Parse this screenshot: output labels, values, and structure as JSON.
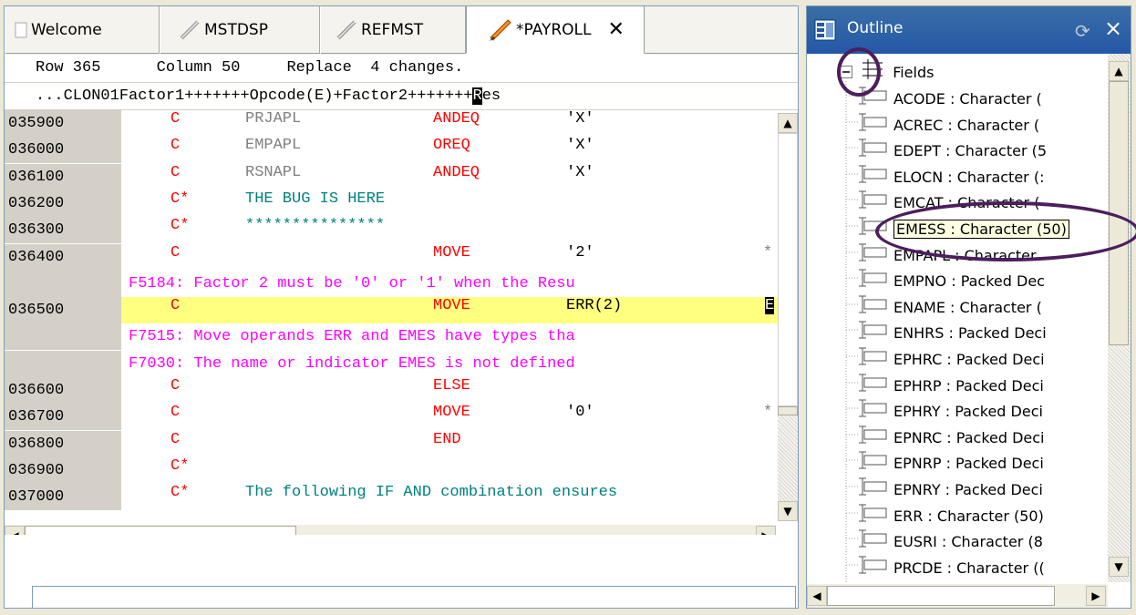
{
  "tabs": [
    {
      "label": "Welcome",
      "icon": "page-icon"
    },
    {
      "label": "MSTDSP",
      "icon": "pencil-icon"
    },
    {
      "label": "REFMST",
      "icon": "pencil-icon"
    },
    {
      "label": "*PAYROLL",
      "icon": "pencil-icon",
      "active": true
    }
  ],
  "editor": {
    "status": "Row 365      Column 50     Replace  4 changes.",
    "ruler_prefix": "...CLON01Factor1+++++++Opcode(E)+Factor2+++++++",
    "ruler_hl": "R",
    "ruler_suffix": "es",
    "lines": [
      {
        "seq": "035900",
        "spec": "C",
        "f1": "PRJAPL",
        "op": "ANDEQ",
        "f2": "'X'"
      },
      {
        "seq": "036000",
        "spec": "C",
        "f1": "EMPAPL",
        "op": "OREQ",
        "f2": "'X'"
      },
      {
        "seq": "036100",
        "spec": "C",
        "f1": "RSNAPL",
        "op": "ANDEQ",
        "f2": "'X'"
      },
      {
        "seq": "036200",
        "spec": "C*",
        "cmt": "THE BUG IS HERE"
      },
      {
        "seq": "036300",
        "spec": "C*",
        "cmt": "***************"
      },
      {
        "seq": "036400",
        "spec": "C",
        "op": "MOVE",
        "f2": "'2'",
        "star": "*"
      },
      {
        "msg": "F5184: Factor 2 must be '0' or '1' when the Resu"
      },
      {
        "seq": "036500",
        "spec": "C",
        "op": "MOVE",
        "f2": "ERR(2)",
        "eblk": "E",
        "current": true
      },
      {
        "msg": "F7515: Move operands ERR and EMES have types tha"
      },
      {
        "msg": "F7030: The name or indicator EMES is not defined"
      },
      {
        "seq": "036600",
        "spec": "C",
        "op": "ELSE"
      },
      {
        "seq": "036700",
        "spec": "C",
        "op": "MOVE",
        "f2": "'0'",
        "star": "*"
      },
      {
        "seq": "036800",
        "spec": "C",
        "op": "END"
      },
      {
        "seq": "036900",
        "spec": "C*"
      },
      {
        "seq": "037000",
        "spec": "C*",
        "cmt": "The following IF AND combination ensures"
      }
    ],
    "command_value": ""
  },
  "outline": {
    "title": "Outline",
    "root": "Fields",
    "items": [
      "ACODE : Character (",
      "ACREC : Character (",
      "EDEPT : Character (5",
      "ELOCN : Character (:",
      "EMCAT : Character (",
      "EMESS : Character (50)",
      "EMPAPL : Character",
      "EMPNO : Packed Dec",
      "ENAME : Character (",
      "ENHRS : Packed Deci",
      "EPHRC : Packed Deci",
      "EPHRP : Packed Deci",
      "EPHRY : Packed Deci",
      "EPNRC : Packed Deci",
      "EPNRP : Packed Deci",
      "EPNRY : Packed Deci",
      "ERR : Character (50)",
      "EUSRI : Character (8",
      "PRCDE : Character (("
    ],
    "selected_index": 5
  },
  "colors": {
    "error_message": "#ff00ff",
    "opcode": "#ff0000",
    "comment": "#008080",
    "current_line": "#ffff80",
    "annotation_oval": "#4b1e5c"
  }
}
